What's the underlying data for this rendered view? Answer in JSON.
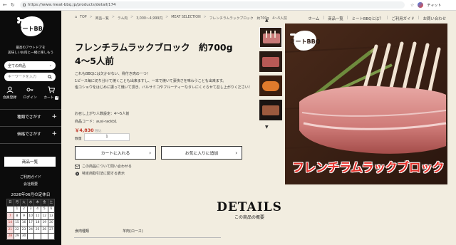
{
  "browser": {
    "url": "https://www.meat-bbq.jp/products/detail/174",
    "chat_label": "チャット"
  },
  "sidebar": {
    "logo_text": "ミートBBQ",
    "tagline_1": "最高のアウトドアを",
    "tagline_2": "美味しいお肉と一緒に楽しもう",
    "category_select": "全ての商品",
    "search_placeholder": "キーワードを入力",
    "icons": [
      {
        "label": "会員登録",
        "icon": "user-icon"
      },
      {
        "label": "ログイン",
        "icon": "key-icon"
      },
      {
        "label": "カート",
        "icon": "cart-icon",
        "count": "0"
      }
    ],
    "sections": [
      {
        "label": "種類でさがす"
      },
      {
        "label": "価格でさがす"
      }
    ],
    "list_button": "商品一覧",
    "links": [
      "ご利用ガイド",
      "会社概要"
    ],
    "calendar": {
      "title": "2026年06月の定休日",
      "weekdays": [
        "日",
        "月",
        "火",
        "水",
        "木",
        "金",
        "土"
      ],
      "rows": [
        [
          "",
          "1",
          "2",
          "3",
          "4",
          "5",
          "6"
        ],
        [
          "7",
          "8",
          "9",
          "10",
          "11",
          "12",
          "13"
        ],
        [
          "14",
          "15",
          "16",
          "17",
          "18",
          "19",
          "20"
        ],
        [
          "21",
          "22",
          "23",
          "24",
          "25",
          "26",
          "27"
        ],
        [
          "28",
          "29",
          "30",
          "",
          "",
          "",
          ""
        ]
      ]
    }
  },
  "breadcrumb": [
    "TOP",
    "商品一覧",
    "ラム肉",
    "3,000〜4,999円",
    "MEAT SELECTION",
    "フレンチラムラックブロック　約700g　4〜5人前"
  ],
  "topnav": [
    "ホーム",
    "商品一覧",
    "ミートBBQとは？",
    "ご利用ガイド",
    "お問い合わせ"
  ],
  "product": {
    "title_line1": "フレンチラムラックブロック　約700g",
    "title_line2": "4〜5人前",
    "desc_1": "これもBBQには欠かせない、骨付き肉の一つ！",
    "desc_2": "1ピース毎に切り分けて焼くことも出来ますし、一本で焼いて豪快さを味わうことも出来ます。",
    "desc_3": "塩コショウをはじめに振って焼いて頂き、バルサミコやフルーティーなタレにくぐらせて召し上がりください！",
    "servings": "お召し上がり人数設定：4〜5人前",
    "code": "商品コード：ausl-rackb1",
    "price": "￥4,830",
    "tax_label": "税込",
    "qty_label": "数量",
    "qty_value": "1",
    "add_to_cart": "カートに入れる",
    "add_to_favorite": "お気に入りに追加",
    "inquiry_link": "この商品について問い合わせる",
    "law_link": "特定商取引法に関する表示",
    "image_caption": "フレンチラムラックブロック",
    "image_logo": "ミートBBQ"
  },
  "details": {
    "heading": "DETAILS",
    "subheading": "この商品の概要",
    "spec_key": "食肉種類",
    "spec_value": "羊肉(ロース)"
  },
  "colors": {
    "sidebar_bg": "#0c0c0c",
    "page_bg": "#f2ede0",
    "price": "#c0392b",
    "caption": "#e4312b"
  }
}
